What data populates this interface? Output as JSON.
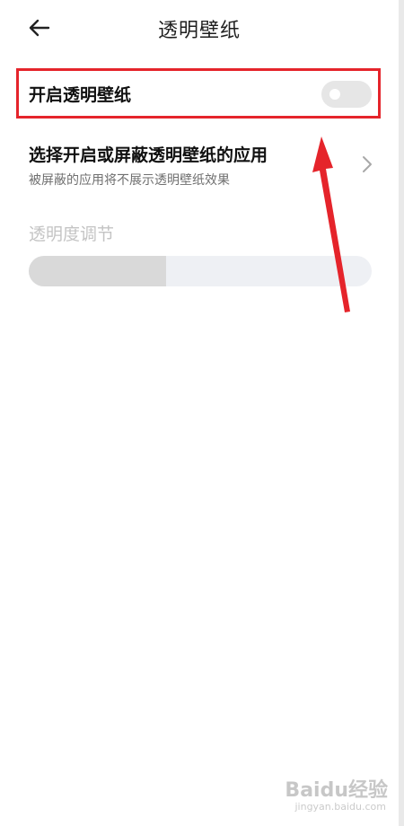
{
  "header": {
    "title": "透明壁纸",
    "back_icon": "arrow-left-icon"
  },
  "toggle_row": {
    "label": "开启透明壁纸",
    "enabled": false
  },
  "apps_row": {
    "title": "选择开启或屏蔽透明壁纸的应用",
    "subtitle": "被屏蔽的应用将不展示透明壁纸效果",
    "chevron_icon": "chevron-right-icon"
  },
  "transparency": {
    "label": "透明度调节",
    "level": 0.4,
    "disabled": true
  },
  "annotation": {
    "box_color": "#e5242b",
    "arrow_color": "#e5242b"
  },
  "watermark": {
    "main": "Baidu经验",
    "sub": "jingyan.baidu.com"
  }
}
